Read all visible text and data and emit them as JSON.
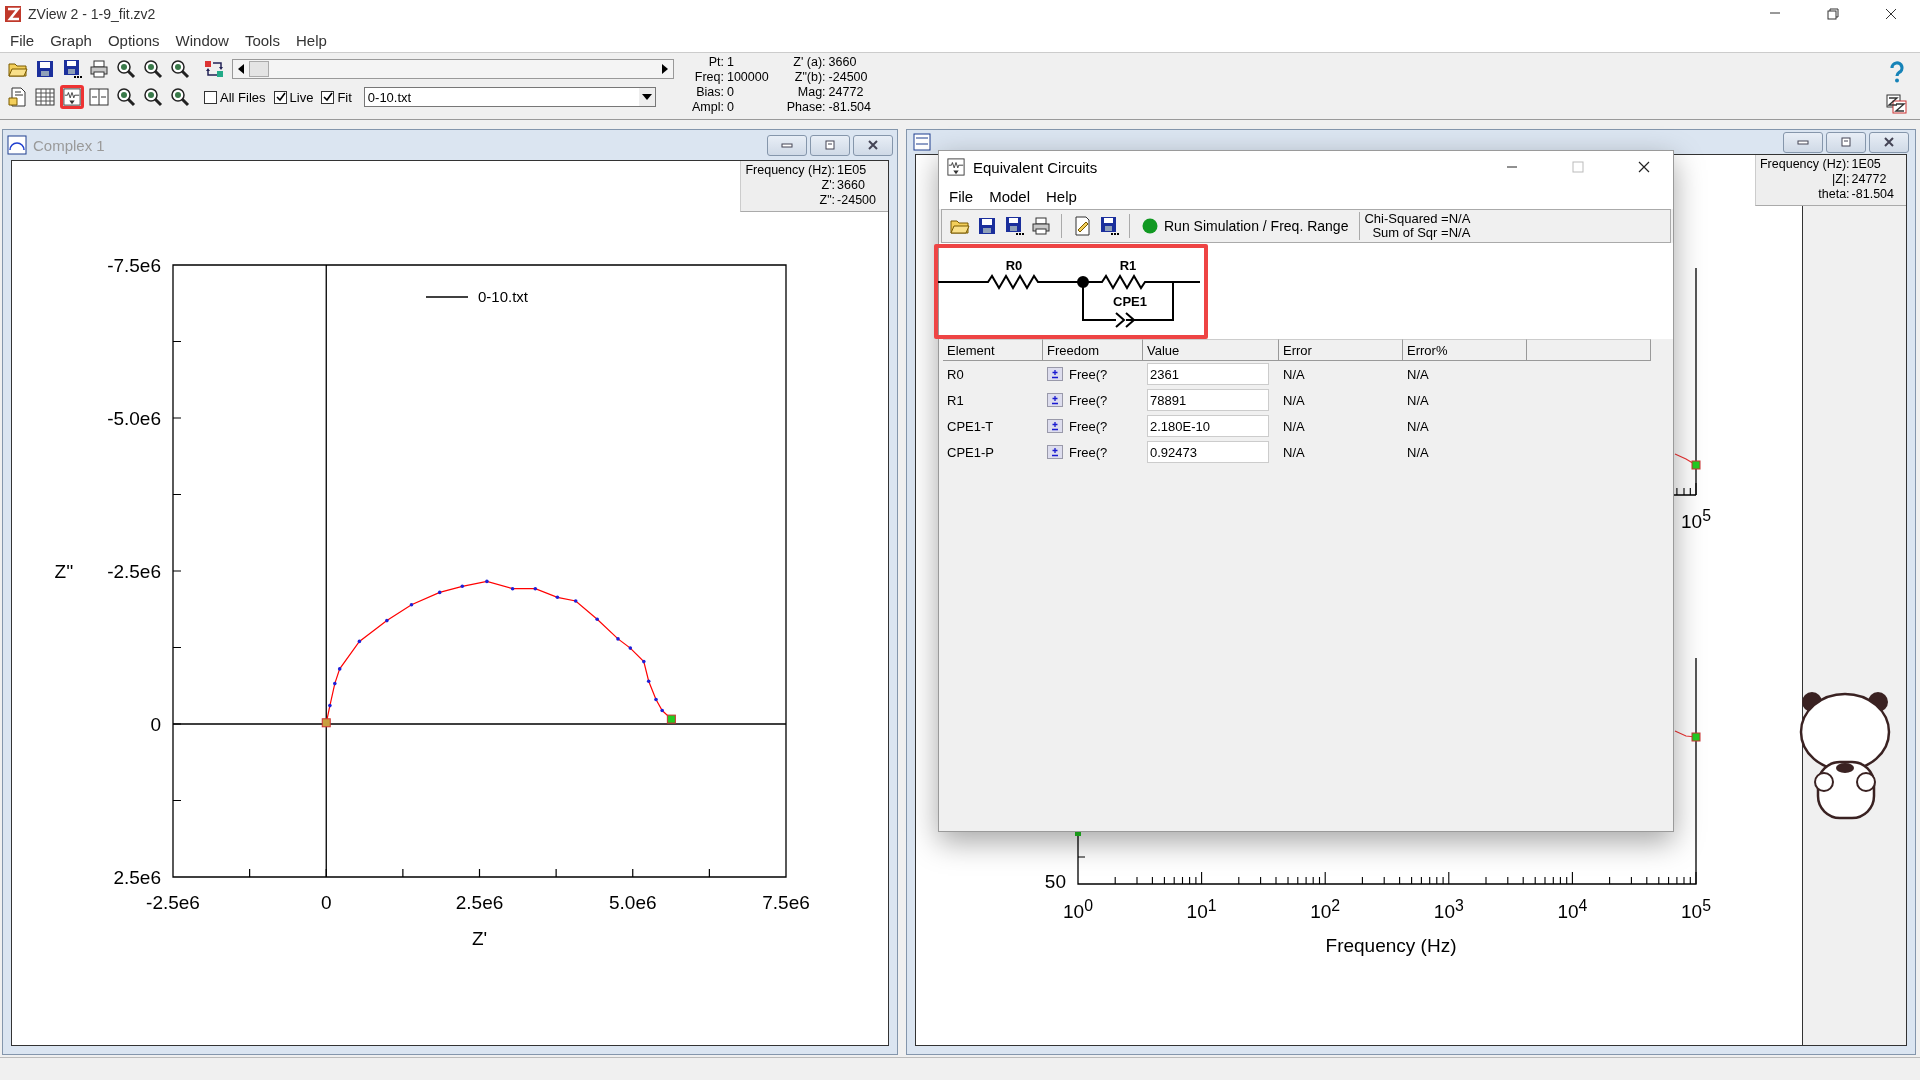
{
  "window": {
    "title": "ZView 2 - 1-9_fit.zv2"
  },
  "menu": [
    {
      "label": "File"
    },
    {
      "label": "Graph"
    },
    {
      "label": "Options"
    },
    {
      "label": "Window"
    },
    {
      "label": "Tools"
    },
    {
      "label": "Help"
    }
  ],
  "toolbar": {
    "rows": [
      [
        {
          "kind": "open",
          "highlighted": false
        },
        {
          "kind": "save",
          "highlighted": false
        },
        {
          "kind": "save-as",
          "highlighted": false
        },
        {
          "kind": "print",
          "highlighted": false
        },
        {
          "kind": "zoom",
          "highlighted": false
        },
        {
          "kind": "zoom",
          "highlighted": false
        },
        {
          "kind": "zoom",
          "highlighted": false
        }
      ],
      [
        {
          "kind": "doc",
          "highlighted": false
        },
        {
          "kind": "table",
          "highlighted": false
        },
        {
          "kind": "circuit",
          "highlighted": true
        },
        {
          "kind": "split",
          "highlighted": false
        },
        {
          "kind": "zoom",
          "highlighted": false
        },
        {
          "kind": "zoom",
          "highlighted": false
        },
        {
          "kind": "zoom",
          "highlighted": false
        }
      ]
    ],
    "checkboxes": [
      {
        "label": "All Files",
        "checked": false
      },
      {
        "label": "Live",
        "checked": true
      },
      {
        "label": "Fit",
        "checked": true
      }
    ],
    "file_combo": {
      "value": "0-10.txt"
    },
    "readouts": [
      [
        {
          "label": "Pt:",
          "value": "1"
        },
        {
          "label": "Freq:",
          "value": "100000"
        },
        {
          "label": "Bias:",
          "value": "0"
        },
        {
          "label": "Ampl:",
          "value": "0"
        }
      ],
      [
        {
          "label": "Z' (a):",
          "value": "3660"
        },
        {
          "label": "Z\"(b):",
          "value": "-24500"
        },
        {
          "label": "Mag:",
          "value": "24772"
        },
        {
          "label": "Phase:",
          "value": "-81.504"
        }
      ]
    ]
  },
  "complex": {
    "title": "Complex 1",
    "active": false,
    "info": [
      {
        "label": "Frequency (Hz):",
        "value": "1E05"
      },
      {
        "label": "Z':",
        "value": "3660"
      },
      {
        "label": "Z\":",
        "value": "-24500"
      }
    ],
    "chart_data": {
      "type": "line",
      "xlabel": "Z'",
      "ylabel": "Z''",
      "x": [
        0,
        60000,
        140000,
        220000,
        540000,
        990000,
        1390000,
        1850000,
        2220000,
        2620000,
        3040000,
        3410000,
        3770000,
        4070000,
        4420000,
        4760000,
        4960000,
        5180000,
        5260000,
        5380000,
        5480000,
        5630000
      ],
      "series": [
        {
          "name": "0-10.txt",
          "color": "#ff0000",
          "values": [
            -20000,
            -300000,
            -660000,
            -900000,
            -1350000,
            -1690000,
            -1950000,
            -2150000,
            -2250000,
            -2330000,
            -2210000,
            -2210000,
            -2070000,
            -2010000,
            -1710000,
            -1390000,
            -1240000,
            -1020000,
            -700000,
            -400000,
            -220000,
            -80000
          ]
        }
      ],
      "xlim": [
        -2500000,
        7500000
      ],
      "ylim": [
        2500000,
        -7500000
      ],
      "xticks": [
        {
          "value": -2500000,
          "label": "-2.5e6"
        },
        {
          "value": 0,
          "label": "0"
        },
        {
          "value": 2500000,
          "label": "2.5e6"
        },
        {
          "value": 5000000,
          "label": "5.0e6"
        },
        {
          "value": 7500000,
          "label": "7.5e6"
        }
      ],
      "yticks": [
        {
          "value": -7500000,
          "label": "-7.5e6"
        },
        {
          "value": -5000000,
          "label": "-5.0e6"
        },
        {
          "value": -2500000,
          "label": "-2.5e6"
        },
        {
          "value": 0,
          "label": "0"
        },
        {
          "value": 2500000,
          "label": "2.5e6"
        }
      ]
    }
  },
  "bode": {
    "info": [
      {
        "label": "Frequency (Hz):",
        "value": "1E05"
      },
      {
        "label": "|Z|:",
        "value": "24772"
      },
      {
        "label": "theta:",
        "value": "-81.504"
      }
    ],
    "upper_xtick": "10$^{5}$",
    "xticks": [
      "10$^{0}$",
      "10$^{1}$",
      "10$^{2}$",
      "10$^{3}$",
      "10$^{4}$",
      "10$^{5}$"
    ],
    "ytick": "50",
    "xlabel": "Frequency (Hz)"
  },
  "dialog": {
    "title": "Equivalent Circuits",
    "active": true,
    "menu": [
      "File",
      "Model",
      "Help"
    ],
    "tools": [
      {
        "kind": "open"
      },
      {
        "kind": "save"
      },
      {
        "kind": "save-as"
      },
      {
        "kind": "print"
      },
      {
        "kind": "separator"
      },
      {
        "kind": "edit"
      },
      {
        "kind": "save-as"
      },
      {
        "kind": "separator"
      }
    ],
    "run_button": {
      "label": "Run Simulation / Freq. Range"
    },
    "stats": [
      "Chi-Squared =N/A",
      "Sum of Sqr =N/A"
    ],
    "circuit": {
      "highlighted": true,
      "labels": [
        "R0",
        "R1",
        "CPE1"
      ]
    },
    "table": {
      "columns": [
        "Element",
        "Freedom",
        "Value",
        "Error",
        "Error%"
      ],
      "rows": [
        {
          "element": "R0",
          "freedom": "Free(?",
          "value": "2361",
          "error": "N/A",
          "error_pct": "N/A"
        },
        {
          "element": "R1",
          "freedom": "Free(?",
          "value": "78891",
          "error": "N/A",
          "error_pct": "N/A"
        },
        {
          "element": "CPE1-T",
          "freedom": "Free(?",
          "value": "2.180E-10",
          "error": "N/A",
          "error_pct": "N/A"
        },
        {
          "element": "CPE1-P",
          "freedom": "Free(?",
          "value": "0.92473",
          "error": "N/A",
          "error_pct": "N/A"
        }
      ]
    }
  }
}
